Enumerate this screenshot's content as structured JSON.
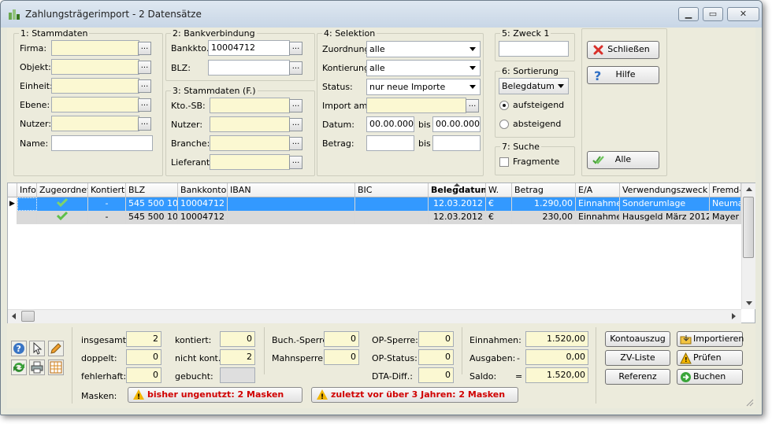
{
  "window": {
    "title": "Zahlungsträgerimport - 2 Datensätze"
  },
  "stammdaten": {
    "title": "1: Stammdaten",
    "fields": [
      {
        "label": "Firma:",
        "value": ""
      },
      {
        "label": "Objekt:",
        "value": ""
      },
      {
        "label": "Einheit:",
        "value": ""
      },
      {
        "label": "Ebene:",
        "value": ""
      },
      {
        "label": "Nutzer:",
        "value": ""
      },
      {
        "label": "Name:",
        "value": ""
      }
    ]
  },
  "bankverbindung": {
    "title": "2: Bankverbindung",
    "bankkto_label": "Bankkto.:",
    "bankkto_value": "10004712",
    "blz_label": "BLZ:",
    "blz_value": ""
  },
  "stammdaten_f": {
    "title": "3: Stammdaten (F.)",
    "fields": [
      {
        "label": "Kto.-SB:",
        "value": ""
      },
      {
        "label": "Nutzer:",
        "value": ""
      },
      {
        "label": "Branche:",
        "value": ""
      },
      {
        "label": "Lieferant:",
        "value": ""
      }
    ]
  },
  "selektion": {
    "title": "4: Selektion",
    "zuordnung_label": "Zuordnung:",
    "zuordnung_value": "alle",
    "kontierung_label": "Kontierung:",
    "kontierung_value": "alle",
    "status_label": "Status:",
    "status_value": "nur neue Importe",
    "import_label": "Import am:",
    "import_value": "",
    "datum_label": "Datum:",
    "datum_from": "00.00.0000",
    "bis": "bis",
    "datum_to": "00.00.0000",
    "betrag_label": "Betrag:",
    "betrag_from": "",
    "betrag_to": ""
  },
  "zweck": {
    "title": "5: Zweck 1",
    "value": ""
  },
  "sortierung": {
    "title": "6: Sortierung",
    "value": "Belegdatum",
    "asc": "aufsteigend",
    "desc": "absteigend"
  },
  "suche": {
    "title": "7: Suche",
    "fragmente": "Fragmente"
  },
  "buttons": {
    "schliessen": "Schließen",
    "hilfe": "Hilfe",
    "alle": "Alle"
  },
  "table": {
    "columns": [
      "Info",
      "Zugeordnet",
      "Kontiert",
      "BLZ",
      "Bankkonto",
      "IBAN",
      "BIC",
      "Belegdatum",
      "W.",
      "Betrag",
      "E/A",
      "Verwendungszweck",
      "Fremd-N"
    ],
    "rows": [
      {
        "info": "",
        "zugeordnet": "check",
        "kontiert": "-",
        "blz": "545 500 10",
        "bankkonto": "10004712",
        "iban": "",
        "bic": "",
        "belegdatum": "12.03.2012",
        "w": "€",
        "betrag": "1.290,00",
        "ea": "Einnahme",
        "zweck": "Sonderumlage",
        "fremd": "Neuma"
      },
      {
        "info": "",
        "zugeordnet": "check",
        "kontiert": "-",
        "blz": "545 500 10",
        "bankkonto": "10004712",
        "iban": "",
        "bic": "",
        "belegdatum": "12.03.2012",
        "w": "€",
        "betrag": "230,00",
        "ea": "Einnahme",
        "zweck": "Hausgeld März 2012",
        "fremd": "Mayer"
      }
    ]
  },
  "stats": {
    "insgesamt_label": "insgesamt:",
    "insgesamt": "2",
    "doppelt_label": "doppelt:",
    "doppelt": "0",
    "fehlerhaft_label": "fehlerhaft:",
    "fehlerhaft": "0",
    "kontiert_label": "kontiert:",
    "kontiert": "0",
    "nichtkont_label": "nicht kont.:",
    "nichtkont": "2",
    "gebucht_label": "gebucht:",
    "gebucht": "",
    "buchsperre_label": "Buch.-Sperre:",
    "buchsperre": "0",
    "mahnsperre_label": "Mahnsperre:",
    "mahnsperre": "0",
    "opsperre_label": "OP-Sperre:",
    "opsperre": "0",
    "opstatus_label": "OP-Status:",
    "opstatus": "0",
    "dtadiff_label": "DTA-Diff.:",
    "dtadiff": "0",
    "einnahmen_label": "Einnahmen:",
    "einnahmen": "1.520,00",
    "ausgaben_label": "Ausgaben:",
    "ausgaben_sign": "-",
    "ausgaben": "0,00",
    "saldo_label": "Saldo:",
    "saldo_sign": "=",
    "saldo": "1.520,00"
  },
  "masken": {
    "label": "Masken:",
    "warn1": "bisher ungenutzt: 2 Masken",
    "warn2": "zuletzt vor über 3 Jahren: 2 Masken"
  },
  "actions": {
    "kontoauszug": "Kontoauszug",
    "importieren": "Importieren",
    "zvliste": "ZV-Liste",
    "pruefen": "Prüfen",
    "referenz": "Referenz",
    "buchen": "Buchen"
  },
  "colors": {
    "selection": "#3399ff",
    "input_yellow": "#fbf8d2",
    "panel": "#ecebdc",
    "warn_text": "#d00000"
  }
}
